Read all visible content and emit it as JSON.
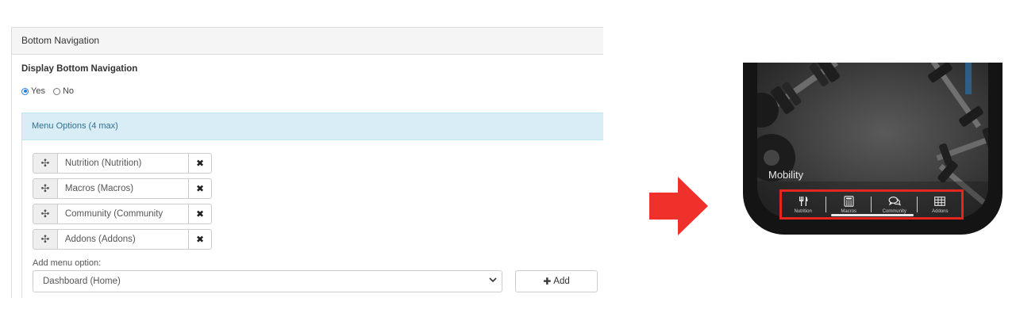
{
  "panel": {
    "heading": "Bottom Navigation",
    "display_label": "Display Bottom Navigation",
    "radio": {
      "yes": "Yes",
      "no": "No",
      "selected": "Yes"
    }
  },
  "menu_options": {
    "heading": "Menu Options (4 max)",
    "items": [
      {
        "label": "Nutrition (Nutrition)"
      },
      {
        "label": "Macros (Macros)"
      },
      {
        "label": "Community (Community"
      },
      {
        "label": "Addons (Addons)"
      }
    ],
    "add_label": "Add menu option:",
    "select_value": "Dashboard (Home)",
    "add_button": "Add"
  },
  "phone": {
    "screen_title": "Mobility",
    "nav": [
      {
        "label": "Nutrition",
        "icon": "fork-knife-icon"
      },
      {
        "label": "Macros",
        "icon": "calculator-icon"
      },
      {
        "label": "Community",
        "icon": "chat-bubbles-icon"
      },
      {
        "label": "Addons",
        "icon": "grid-table-icon"
      }
    ]
  },
  "colors": {
    "highlight": "#e5261e",
    "arrow": "#f0302a",
    "info_bg": "#d9edf7",
    "info_text": "#31708f",
    "radio_accent": "#2a7ae2"
  }
}
